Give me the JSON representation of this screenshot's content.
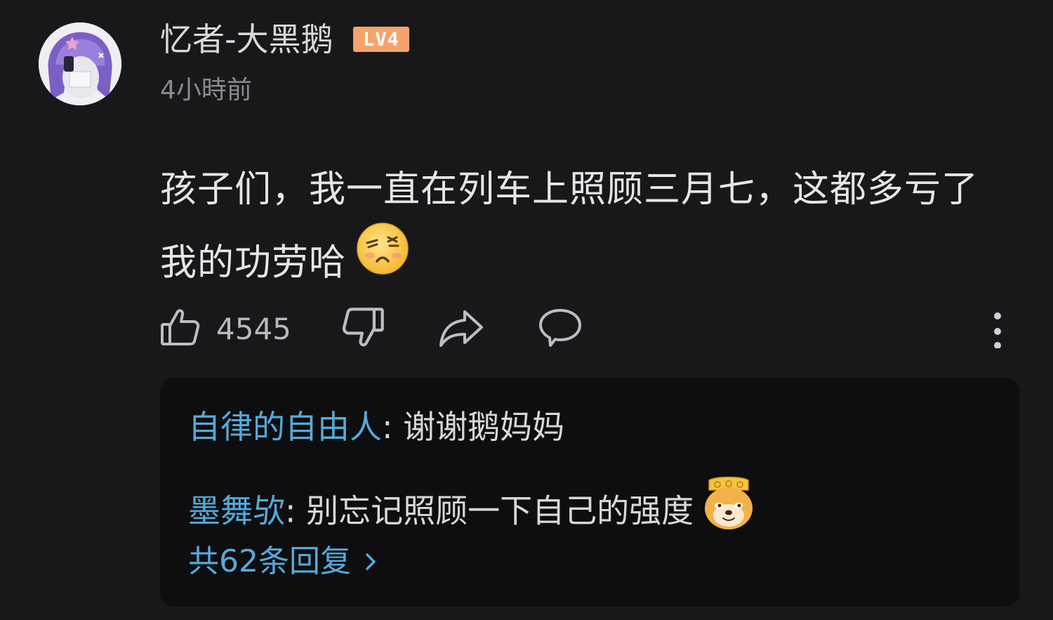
{
  "comment": {
    "username": "忆者-大黑鹅",
    "level_badge": "LV4",
    "timestamp": "4小時前",
    "content_line1": "孩子们，我一直在列车上照顾三月七，这都多亏了",
    "content_line2": "我的功劳哈",
    "content_emoji": "smug-face-emoji"
  },
  "actions": {
    "like_count": "4545",
    "like_icon": "thumbs-up-icon",
    "dislike_icon": "thumbs-down-icon",
    "share_icon": "share-arrow-icon",
    "comment_icon": "speech-bubble-icon",
    "more_icon": "vertical-dots-icon"
  },
  "replies": [
    {
      "author": "自律的自由人",
      "separator": ":",
      "text": " 谢谢鹅妈妈"
    },
    {
      "author": "墨舞欤",
      "separator": ":",
      "text": " 别忘记照顾一下自己的强度",
      "emoji": "doge-emoji"
    }
  ],
  "more_replies_label": "共62条回复",
  "colors": {
    "background": "#18181a",
    "reply_box": "#0e0e10",
    "link_blue": "#57a9d8",
    "level_badge": "#f5a36d"
  }
}
